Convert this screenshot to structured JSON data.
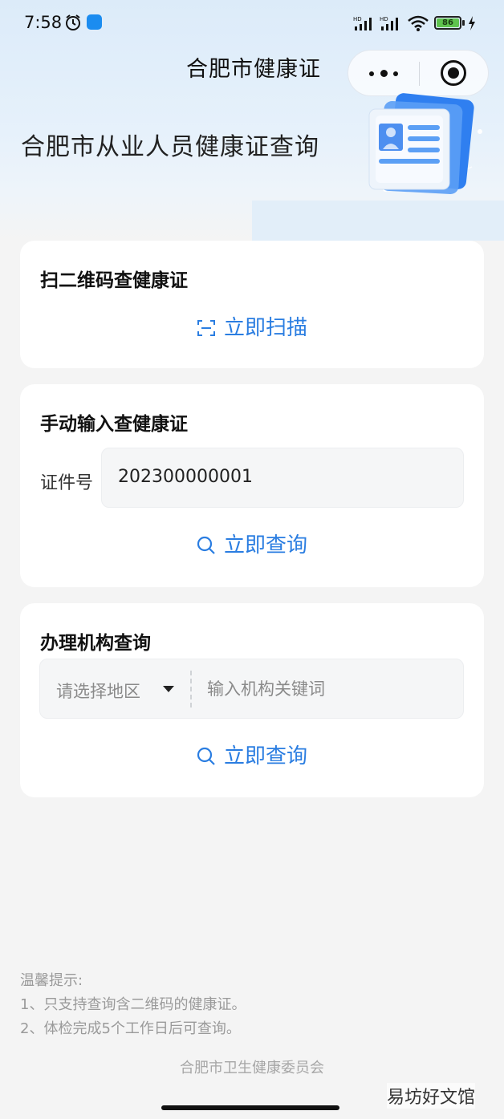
{
  "status_bar": {
    "time": "7:58",
    "battery_level": "86",
    "signal_labels": [
      "HD",
      "HD"
    ]
  },
  "nav": {
    "title": "合肥市健康证"
  },
  "header": {
    "heading": "合肥市从业人员健康证查询"
  },
  "scan_card": {
    "title": "扫二维码查健康证",
    "action_label": "立即扫描"
  },
  "manual_card": {
    "title": "手动输入查健康证",
    "field_label": "证件号",
    "field_value": "202300000001",
    "action_label": "立即查询"
  },
  "org_card": {
    "title": "办理机构查询",
    "region_placeholder": "请选择地区",
    "keyword_placeholder": "输入机构关键词",
    "action_label": "立即查询"
  },
  "tips": {
    "heading": "温馨提示:",
    "items": [
      "1、只支持查询含二维码的健康证。",
      "2、体检完成5个工作日后可查询。"
    ]
  },
  "footer": {
    "org": "合肥市卫生健康委员会"
  },
  "watermark": "易坊好文馆",
  "colors": {
    "accent": "#2a7de1",
    "header_bg": "#dcebf9",
    "page_bg": "#f4f4f4"
  },
  "icons": {
    "scan": "scan-icon",
    "search": "search-icon",
    "alarm": "alarm-icon",
    "more": "more-icon",
    "close": "close-icon"
  }
}
